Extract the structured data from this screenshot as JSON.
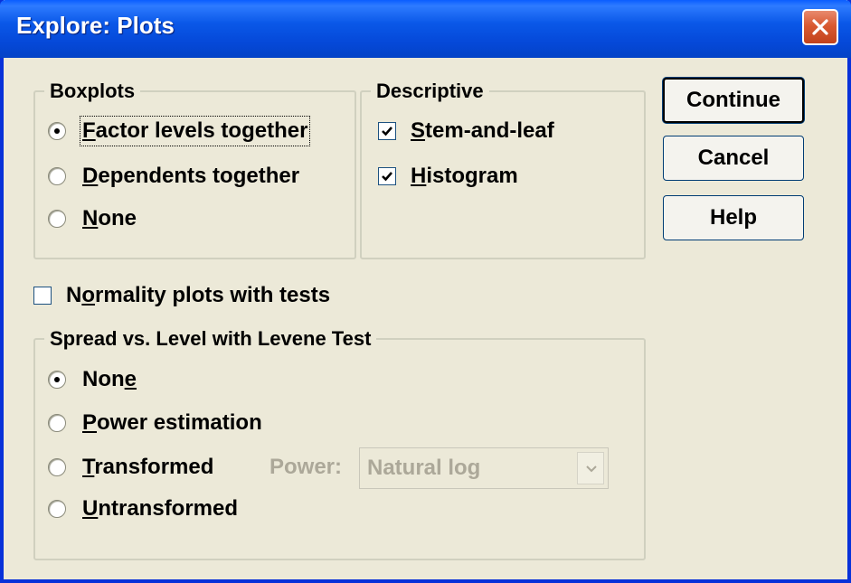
{
  "window": {
    "title": "Explore: Plots"
  },
  "boxplots": {
    "legend": "Boxplots",
    "options": [
      {
        "pre": "",
        "key": "F",
        "post": "actor levels together",
        "selected": true
      },
      {
        "pre": "",
        "key": "D",
        "post": "ependents together",
        "selected": false
      },
      {
        "pre": "",
        "key": "N",
        "post": "one",
        "selected": false
      }
    ]
  },
  "descriptive": {
    "legend": "Descriptive",
    "stem_and_leaf": {
      "pre": "",
      "key": "S",
      "post": "tem-and-leaf",
      "checked": true
    },
    "histogram": {
      "pre": "",
      "key": "H",
      "post": "istogram",
      "checked": true
    }
  },
  "normality": {
    "pre": "N",
    "key": "o",
    "post": "rmality plots with tests",
    "checked": false
  },
  "spread": {
    "legend": "Spread vs. Level with Levene Test",
    "options": [
      {
        "pre": "Non",
        "key": "e",
        "post": "",
        "selected": true
      },
      {
        "pre": "",
        "key": "P",
        "post": "ower estimation",
        "selected": false
      },
      {
        "pre": "",
        "key": "T",
        "post": "ransformed",
        "selected": false
      },
      {
        "pre": "",
        "key": "U",
        "post": "ntransformed",
        "selected": false
      }
    ],
    "power_label": "Power:",
    "power_value": "Natural log"
  },
  "buttons": {
    "continue": "Continue",
    "cancel": "Cancel",
    "help": "Help"
  },
  "colors": {
    "title_bar": "#0A58E8",
    "dialog_bg": "#ECE9D8",
    "disabled_text": "#ACA899",
    "close_button": "#D95A32"
  }
}
